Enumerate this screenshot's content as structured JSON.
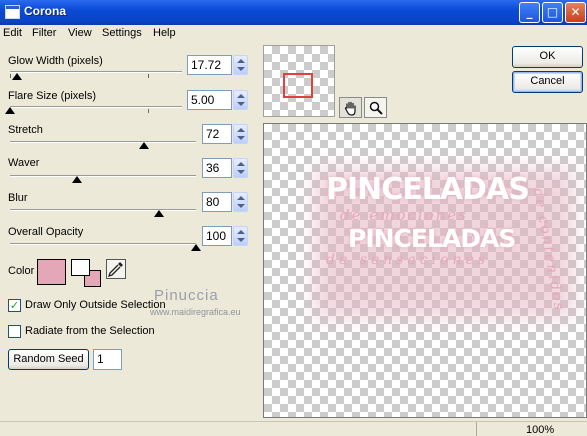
{
  "window": {
    "title": "Corona",
    "minimize": "_",
    "maximize": "□",
    "close": "✕"
  },
  "menu": [
    "Edit",
    "Filter",
    "View",
    "Settings",
    "Help"
  ],
  "controls": {
    "glow_width": {
      "label": "Glow Width (pixels)",
      "value": "17.72",
      "level": 0.04
    },
    "flare_size": {
      "label": "Flare Size (pixels)",
      "value": "5.00",
      "level": 0.0
    },
    "stretch": {
      "label": "Stretch",
      "value": "72",
      "level": 0.72
    },
    "waver": {
      "label": "Waver",
      "value": "36",
      "level": 0.36
    },
    "blur": {
      "label": "Blur",
      "value": "80",
      "level": 0.8
    },
    "overall_opacity": {
      "label": "Overall Opacity",
      "value": "100",
      "level": 1.0
    }
  },
  "color": {
    "label": "Color",
    "swatch": "#e3a7b8",
    "fg": "#ffffff",
    "bg": "#e3a7b8",
    "picker_icon": "eyedropper-icon"
  },
  "checkboxes": {
    "draw_only_outside": {
      "label": "Draw Only Outside Selection",
      "checked": true
    },
    "radiate": {
      "label": "Radiate from the Selection",
      "checked": false
    }
  },
  "random_seed": {
    "label": "Random Seed",
    "value": "1"
  },
  "buttons": {
    "ok": "OK",
    "cancel": "Cancel"
  },
  "tools": {
    "pan": "hand-icon",
    "zoom": "magnifier-icon"
  },
  "preview_watermark": {
    "line1": "PINCELADAS",
    "line2": "de emociones",
    "line3": "PINCELADAS",
    "line4": "de sensaciones",
    "side": "de contenidos"
  },
  "credit": {
    "name": "Pinuccia",
    "url": "www.maidiregrafica.eu"
  },
  "status": {
    "zoom": "100%"
  }
}
